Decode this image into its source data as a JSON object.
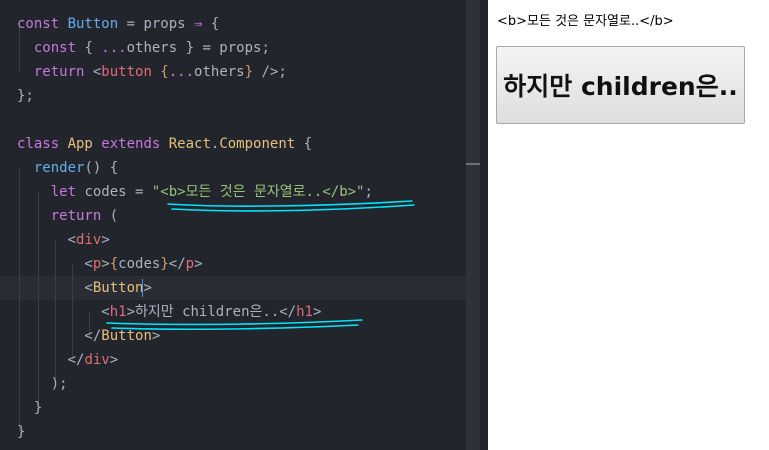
{
  "editor": {
    "lines": [
      [
        {
          "t": "const ",
          "c": "kw"
        },
        {
          "t": "Button",
          "c": "fn"
        },
        {
          "t": " = props ",
          "c": "plain"
        },
        {
          "t": "⇒",
          "c": "op"
        },
        {
          "t": " {",
          "c": "plain"
        }
      ],
      [
        {
          "t": "  const ",
          "c": "kw"
        },
        {
          "t": "{ ",
          "c": "plain"
        },
        {
          "t": "...",
          "c": "op"
        },
        {
          "t": "others } = props;",
          "c": "plain"
        }
      ],
      [
        {
          "t": "  return ",
          "c": "kw"
        },
        {
          "t": "<",
          "c": "plain"
        },
        {
          "t": "button",
          "c": "tag"
        },
        {
          "t": " {",
          "c": "jsx"
        },
        {
          "t": "...",
          "c": "op"
        },
        {
          "t": "others",
          "c": "plain"
        },
        {
          "t": "}",
          "c": "jsx"
        },
        {
          "t": " />;",
          "c": "plain"
        }
      ],
      [
        {
          "t": "};",
          "c": "plain"
        }
      ],
      [],
      [
        {
          "t": "class ",
          "c": "kw"
        },
        {
          "t": "App ",
          "c": "cls"
        },
        {
          "t": "extends ",
          "c": "kw"
        },
        {
          "t": "React",
          "c": "cls"
        },
        {
          "t": ".",
          "c": "plain"
        },
        {
          "t": "Component",
          "c": "cls"
        },
        {
          "t": " {",
          "c": "plain"
        }
      ],
      [
        {
          "t": "  render",
          "c": "fn"
        },
        {
          "t": "() {",
          "c": "plain"
        }
      ],
      [
        {
          "t": "    let ",
          "c": "kw"
        },
        {
          "t": "codes = ",
          "c": "plain"
        },
        {
          "t": "\"<b>모든 것은 문자열로..</b>\"",
          "c": "str"
        },
        {
          "t": ";",
          "c": "plain"
        }
      ],
      [
        {
          "t": "    return ",
          "c": "kw"
        },
        {
          "t": "(",
          "c": "plain"
        }
      ],
      [
        {
          "t": "      <",
          "c": "plain"
        },
        {
          "t": "div",
          "c": "tag"
        },
        {
          "t": ">",
          "c": "plain"
        }
      ],
      [
        {
          "t": "        <",
          "c": "plain"
        },
        {
          "t": "p",
          "c": "tag"
        },
        {
          "t": ">",
          "c": "plain"
        },
        {
          "t": "{",
          "c": "jsx"
        },
        {
          "t": "codes",
          "c": "plain"
        },
        {
          "t": "}",
          "c": "jsx"
        },
        {
          "t": "</",
          "c": "plain"
        },
        {
          "t": "p",
          "c": "tag"
        },
        {
          "t": ">",
          "c": "plain"
        }
      ],
      [
        {
          "t": "        <",
          "c": "plain"
        },
        {
          "t": "Button",
          "c": "cls"
        },
        {
          "t": ">",
          "c": "plain"
        }
      ],
      [
        {
          "t": "          <",
          "c": "plain"
        },
        {
          "t": "h1",
          "c": "tag"
        },
        {
          "t": ">하지만 children은..</",
          "c": "plain"
        },
        {
          "t": "h1",
          "c": "tag"
        },
        {
          "t": ">",
          "c": "plain"
        }
      ],
      [
        {
          "t": "        </",
          "c": "plain"
        },
        {
          "t": "Button",
          "c": "cls"
        },
        {
          "t": ">",
          "c": "plain"
        }
      ],
      [
        {
          "t": "      </",
          "c": "plain"
        },
        {
          "t": "div",
          "c": "tag"
        },
        {
          "t": ">",
          "c": "plain"
        }
      ],
      [
        {
          "t": "    );",
          "c": "plain"
        }
      ],
      [
        {
          "t": "  }",
          "c": "plain"
        }
      ],
      [
        {
          "t": "}",
          "c": "plain"
        }
      ]
    ]
  },
  "preview": {
    "codes_text": "<b>모든 것은 문자열로..</b>",
    "button_text": "하지만 children은.."
  },
  "colors": {
    "editor_bg": "#22252c",
    "keyword": "#c678dd",
    "function": "#61afef",
    "tag": "#e06c75",
    "class": "#e5c07b",
    "string": "#98c379",
    "annotation": "#00e5ff"
  }
}
